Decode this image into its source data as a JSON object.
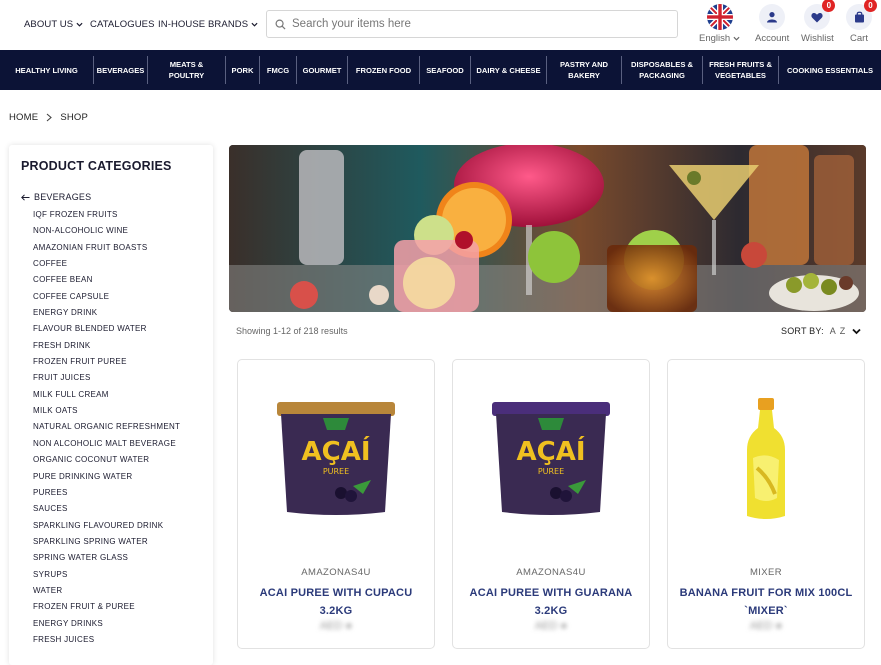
{
  "header": {
    "nav_links": [
      "ABOUT US",
      "CATALOGUES",
      "IN-HOUSE BRANDS"
    ],
    "search_placeholder": "Search your items here",
    "language": "English",
    "account_label": "Account",
    "wishlist_label": "Wishlist",
    "wishlist_count": "0",
    "cart_label": "Cart",
    "cart_count": "0"
  },
  "categories": [
    "HEALTHY LIVING",
    "BEVERAGES",
    "MEATS & POULTRY",
    "PORK",
    "FMCG",
    "GOURMET",
    "FROZEN FOOD",
    "SEAFOOD",
    "DAIRY & CHEESE",
    "PASTRY AND BAKERY",
    "DISPOSABLES & PACKAGING",
    "FRESH FRUITS & VEGETABLES",
    "COOKING ESSENTIALS"
  ],
  "breadcrumb": [
    "HOME",
    "SHOP"
  ],
  "sidebar": {
    "title": "PRODUCT CATEGORIES",
    "parent": "BEVERAGES",
    "items": [
      "IQF FROZEN FRUITS",
      "NON-ALCOHOLIC WINE",
      "AMAZONIAN FRUIT BOASTS",
      "COFFEE",
      "COFFEE BEAN",
      "COFFEE CAPSULE",
      "ENERGY DRINK",
      "FLAVOUR BLENDED WATER",
      "FRESH DRINK",
      "FROZEN FRUIT PUREE",
      "FRUIT JUICES",
      "MILK FULL CREAM",
      "MILK OATS",
      "NATURAL ORGANIC REFRESHMENT",
      "NON ALCOHOLIC MALT BEVERAGE",
      "ORGANIC COCONUT WATER",
      "PURE DRINKING WATER",
      "PUREES",
      "SAUCES",
      "SPARKLING FLAVOURED DRINK",
      "SPARKLING SPRING WATER",
      "SPRING WATER GLASS",
      "SYRUPS",
      "WATER",
      "FROZEN FRUIT & PUREE",
      "ENERGY DRINKS",
      "FRESH JUICES"
    ]
  },
  "results_text": "Showing 1-12 of 218 results",
  "sort": {
    "label": "SORT BY:",
    "value": "A Z"
  },
  "products": [
    {
      "brand": "AMAZONAS4U",
      "name": "ACAI PUREE WITH CUPACU 3.2KG",
      "price": "AED ●",
      "image": "acai-tub-cupuacu"
    },
    {
      "brand": "AMAZONAS4U",
      "name": "ACAI PUREE WITH GUARANA 3.2KG",
      "price": "AED ●",
      "image": "acai-tub-guarana"
    },
    {
      "brand": "MIXER",
      "name": "BANANA FRUIT FOR MIX 100CL `MIXER`",
      "price": "AED ●",
      "image": "banana-mixer-bottle"
    }
  ],
  "colors": {
    "nav_bg": "#0c1336",
    "product_title": "#2b3a7a",
    "badge": "#e02424",
    "icon_bg": "#eef0f7"
  }
}
